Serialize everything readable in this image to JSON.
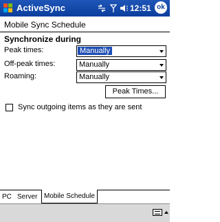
{
  "titlebar": {
    "app_title": "ActiveSync",
    "clock": "12:51",
    "ok_label": "ok"
  },
  "page": {
    "title": "Mobile Sync Schedule",
    "section_title": "Synchronize during"
  },
  "fields": [
    {
      "label": "Peak times:",
      "value": "Manually"
    },
    {
      "label": "Off-peak times:",
      "value": "Manually"
    },
    {
      "label": "Roaming:",
      "value": "Manually"
    }
  ],
  "peak_times_button": "Peak Times...",
  "checkbox": {
    "label": "Sync outgoing items as they are sent",
    "checked": false
  },
  "tabs": [
    {
      "label": "PC"
    },
    {
      "label": "Server"
    },
    {
      "label": "Mobile Schedule",
      "active": true
    }
  ],
  "icons": {
    "start": "windows-flag-icon",
    "connectivity": "connectivity-icon",
    "signal": "signal-icon",
    "volume": "volume-icon",
    "keyboard": "keyboard-icon"
  },
  "colors": {
    "titlebar": "#0b3e9c",
    "selection": "#1f4fb5",
    "command_bar": "#d9d9d9"
  }
}
